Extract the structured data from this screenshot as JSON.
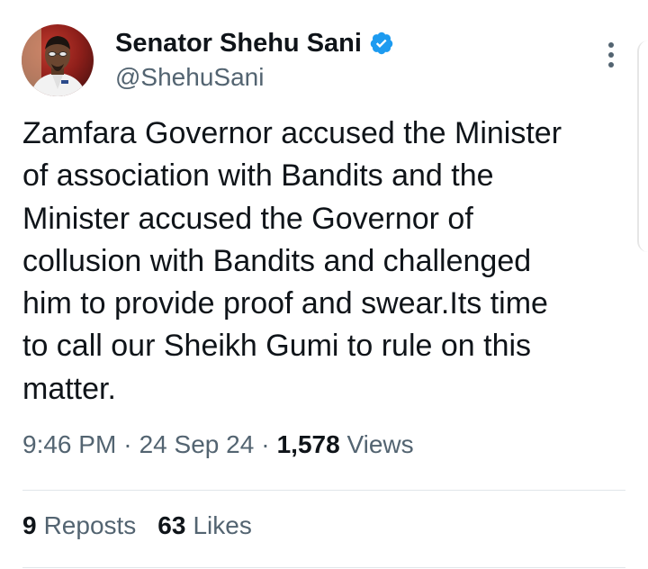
{
  "author": {
    "display_name": "Senator Shehu Sani",
    "handle": "@ShehuSani",
    "verified": true,
    "verified_icon": "verified-badge-icon",
    "verified_color": "#1d9bf0"
  },
  "menu_icon": "more-vertical-icon",
  "tweet": {
    "text": "Zamfara Governor accused the Minister\nof association with Bandits and the\nMinister accused the Governor of\ncollusion with Bandits and challenged\nhim to provide proof and swear.Its time\nto call our Sheikh Gumi to rule on this\nmatter.",
    "time": "9:46 PM",
    "date": "24 Sep 24",
    "separator": "·",
    "views_count": "1,578",
    "views_label": "Views"
  },
  "stats": {
    "reposts_count": "9",
    "reposts_label": "Reposts",
    "likes_count": "63",
    "likes_label": "Likes"
  },
  "colors": {
    "text_primary": "#0f1419",
    "text_secondary": "#536471",
    "divider": "#e1e6ea"
  }
}
